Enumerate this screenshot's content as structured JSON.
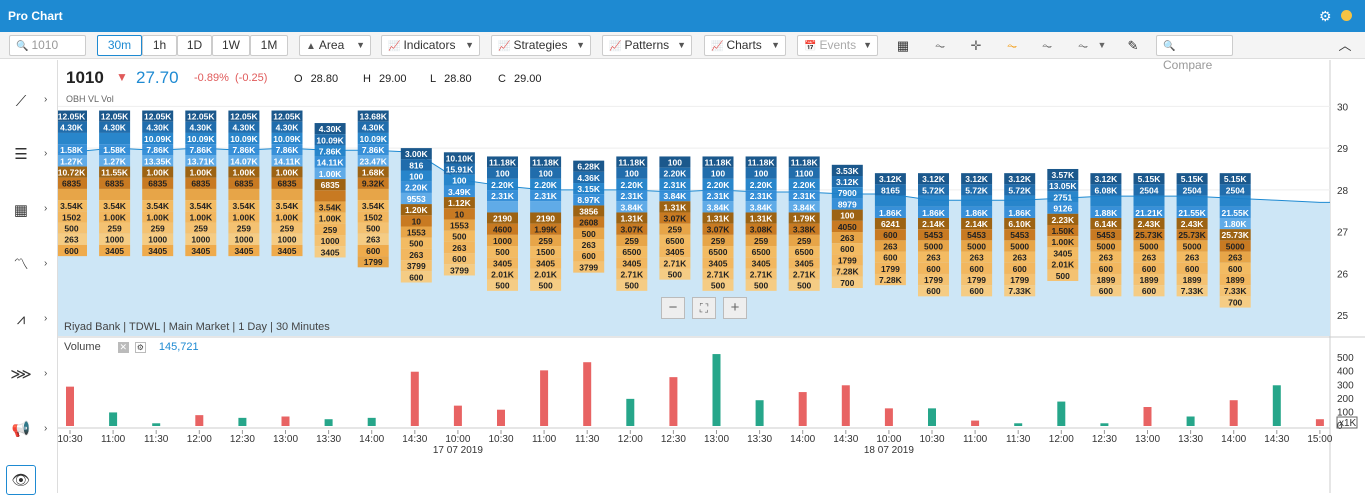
{
  "window": {
    "title": "Pro Chart"
  },
  "toolbar": {
    "search_placeholder": "1010",
    "periods": [
      "30m",
      "1h",
      "1D",
      "1W",
      "1M"
    ],
    "active_period": "30m",
    "chart_type": "Area",
    "indicators": "Indicators",
    "strategies": "Strategies",
    "patterns": "Patterns",
    "charts": "Charts",
    "events": "Events",
    "compare_placeholder": "Compare"
  },
  "quote": {
    "symbol": "1010",
    "last": "27.70",
    "change_pct": "-0.89%",
    "change": "(-0.25)",
    "open_label": "O",
    "open": "28.80",
    "high_label": "H",
    "high": "29.00",
    "low_label": "L",
    "low": "28.80",
    "close_label": "C",
    "close": "29.00",
    "overlay_label": "OBH VL Vol"
  },
  "meta": "Riyad Bank | TDWL | Main Market | 1 Day | 30 Minutes",
  "volume_panel": {
    "label": "Volume",
    "value": "145,721",
    "multiplier": "x1K"
  },
  "colors": {
    "up": "#26a68a",
    "down": "#e86363",
    "area": "#cde6f6",
    "line": "#1e8ad2"
  },
  "chart_data": {
    "type": "area",
    "price_axis": {
      "min": 24.5,
      "max": 30.2,
      "ticks": [
        "30",
        "29",
        "28",
        "27",
        "26",
        "25"
      ]
    },
    "volume_axis": {
      "min": 0,
      "max": 560,
      "ticks": [
        "500",
        "400",
        "300",
        "200",
        "100",
        "0"
      ]
    },
    "x": [
      "10:30",
      "11:00",
      "11:30",
      "12:00",
      "12:30",
      "13:00",
      "13:30",
      "14:00",
      "14:30",
      "10:00",
      "10:30",
      "11:00",
      "11:30",
      "12:00",
      "12:30",
      "13:00",
      "13:30",
      "14:00",
      "14:30",
      "10:00",
      "10:30",
      "11:00",
      "11:30",
      "12:00",
      "12:30",
      "13:00",
      "13:30",
      "14:00",
      "14:30",
      "15:00"
    ],
    "date_labels": [
      {
        "at": "10:00",
        "index": 9,
        "date": "17 07 2019"
      },
      {
        "at": "10:00",
        "index": 19,
        "date": "18 07 2019"
      }
    ],
    "price": [
      28.9,
      29.0,
      28.95,
      29.0,
      28.95,
      29.0,
      28.95,
      28.95,
      28.9,
      28.25,
      28.1,
      28.0,
      28.0,
      28.0,
      27.95,
      28.0,
      27.95,
      27.95,
      27.9,
      27.9,
      27.75,
      27.75,
      27.75,
      27.8,
      27.85,
      27.85,
      27.85,
      27.8,
      27.75,
      27.7
    ],
    "volume": [
      290,
      100,
      20,
      80,
      60,
      70,
      50,
      60,
      400,
      150,
      120,
      410,
      470,
      200,
      360,
      530,
      190,
      250,
      300,
      130,
      130,
      40,
      20,
      180,
      20,
      140,
      70,
      190,
      300,
      50
    ],
    "volume_direction": [
      "down",
      "up",
      "up",
      "down",
      "up",
      "down",
      "up",
      "up",
      "down",
      "down",
      "down",
      "down",
      "down",
      "up",
      "down",
      "up",
      "up",
      "down",
      "down",
      "down",
      "up",
      "down",
      "up",
      "up",
      "up",
      "down",
      "up",
      "down",
      "up",
      "down"
    ],
    "order_book_columns": [
      {
        "top": 29.9,
        "cells": [
          "12.05K",
          "4.30K",
          "",
          "1.58K",
          "1.27K",
          "10.72K",
          "6835",
          "",
          "3.54K",
          "1502",
          "500",
          "263",
          "600"
        ]
      },
      {
        "top": 29.9,
        "cells": [
          "12.05K",
          "4.30K",
          "",
          "1.58K",
          "1.27K",
          "11.55K",
          "6835",
          "",
          "3.54K",
          "1.00K",
          "259",
          "1000",
          "3405"
        ]
      },
      {
        "top": 29.9,
        "cells": [
          "12.05K",
          "4.30K",
          "10.09K",
          "7.86K",
          "13.35K",
          "1.00K",
          "6835",
          "",
          "3.54K",
          "1.00K",
          "259",
          "1000",
          "3405"
        ]
      },
      {
        "top": 29.9,
        "cells": [
          "12.05K",
          "4.30K",
          "10.09K",
          "7.86K",
          "13.71K",
          "1.00K",
          "6835",
          "",
          "3.54K",
          "1.00K",
          "259",
          "1000",
          "3405"
        ]
      },
      {
        "top": 29.9,
        "cells": [
          "12.05K",
          "4.30K",
          "10.09K",
          "7.86K",
          "14.07K",
          "1.00K",
          "6835",
          "",
          "3.54K",
          "1.00K",
          "259",
          "1000",
          "3405"
        ]
      },
      {
        "top": 29.9,
        "cells": [
          "12.05K",
          "4.30K",
          "10.09K",
          "7.86K",
          "14.11K",
          "1.00K",
          "6835",
          "",
          "3.54K",
          "1.00K",
          "259",
          "1000",
          "3405"
        ]
      },
      {
        "top": 29.6,
        "cells": [
          "4.30K",
          "10.09K",
          "7.86K",
          "14.11K",
          "1.00K",
          "6835",
          "",
          "3.54K",
          "1.00K",
          "259",
          "1000",
          "3405"
        ]
      },
      {
        "top": 29.9,
        "cells": [
          "13.68K",
          "4.30K",
          "10.09K",
          "7.86K",
          "23.47K",
          "1.68K",
          "9.32K",
          "",
          "3.54K",
          "1502",
          "500",
          "263",
          "600",
          "1799"
        ]
      },
      {
        "top": 29.0,
        "cells": [
          "3.00K",
          "816",
          "100",
          "2.20K",
          "9553",
          "1.20K",
          "10",
          "1553",
          "500",
          "263",
          "3799",
          "600"
        ]
      },
      {
        "top": 28.9,
        "cells": [
          "10.10K",
          "15.91K",
          "100",
          "3.49K",
          "1.12K",
          "10",
          "1553",
          "500",
          "263",
          "600",
          "3799"
        ]
      },
      {
        "top": 28.8,
        "cells": [
          "11.18K",
          "100",
          "2.20K",
          "2.31K",
          "",
          "2190",
          "4600",
          "1000",
          "500",
          "3405",
          "2.01K",
          "500"
        ]
      },
      {
        "top": 28.8,
        "cells": [
          "11.18K",
          "100",
          "2.20K",
          "2.31K",
          "",
          "2190",
          "1.99K",
          "259",
          "1500",
          "3405",
          "2.01K",
          "500"
        ]
      },
      {
        "top": 28.7,
        "cells": [
          "6.28K",
          "4.36K",
          "3.15K",
          "8.97K",
          "3856",
          "2608",
          "500",
          "263",
          "600",
          "3799"
        ]
      },
      {
        "top": 28.8,
        "cells": [
          "11.18K",
          "100",
          "2.20K",
          "2.31K",
          "3.84K",
          "1.31K",
          "3.07K",
          "259",
          "6500",
          "3405",
          "2.71K",
          "500"
        ]
      },
      {
        "top": 28.8,
        "cells": [
          "100",
          "2.20K",
          "2.31K",
          "3.84K",
          "1.31K",
          "3.07K",
          "259",
          "6500",
          "3405",
          "2.71K",
          "500"
        ]
      },
      {
        "top": 28.8,
        "cells": [
          "11.18K",
          "100",
          "2.20K",
          "2.31K",
          "3.84K",
          "1.31K",
          "3.07K",
          "259",
          "6500",
          "3405",
          "2.71K",
          "500"
        ]
      },
      {
        "top": 28.8,
        "cells": [
          "11.18K",
          "100",
          "2.20K",
          "2.31K",
          "3.84K",
          "1.31K",
          "3.08K",
          "259",
          "6500",
          "3405",
          "2.71K",
          "500"
        ]
      },
      {
        "top": 28.8,
        "cells": [
          "11.18K",
          "1100",
          "2.20K",
          "2.31K",
          "3.84K",
          "1.79K",
          "3.38K",
          "259",
          "6500",
          "3405",
          "2.71K",
          "500"
        ]
      },
      {
        "top": 28.6,
        "cells": [
          "3.53K",
          "3.12K",
          "7900",
          "8979",
          "100",
          "4050",
          "263",
          "600",
          "1799",
          "7.28K",
          "700"
        ]
      },
      {
        "top": 28.4,
        "cells": [
          "3.12K",
          "8165",
          "",
          "1.86K",
          "6241",
          "600",
          "263",
          "600",
          "1799",
          "7.28K"
        ]
      },
      {
        "top": 28.4,
        "cells": [
          "3.12K",
          "5.72K",
          "",
          "1.86K",
          "2.14K",
          "5453",
          "5000",
          "263",
          "600",
          "1799",
          "600"
        ]
      },
      {
        "top": 28.4,
        "cells": [
          "3.12K",
          "5.72K",
          "",
          "1.86K",
          "2.14K",
          "5453",
          "5000",
          "263",
          "600",
          "1799",
          "600"
        ]
      },
      {
        "top": 28.4,
        "cells": [
          "3.12K",
          "5.72K",
          "",
          "1.86K",
          "6.10K",
          "5453",
          "5000",
          "263",
          "600",
          "1799",
          "7.33K"
        ]
      },
      {
        "top": 28.5,
        "cells": [
          "3.57K",
          "13.05K",
          "2751",
          "9126",
          "2.23K",
          "1.50K",
          "1.00K",
          "3405",
          "2.01K",
          "500"
        ]
      },
      {
        "top": 28.4,
        "cells": [
          "3.12K",
          "6.08K",
          "",
          "1.88K",
          "6.14K",
          "5453",
          "5000",
          "263",
          "600",
          "1899",
          "600"
        ]
      },
      {
        "top": 28.4,
        "cells": [
          "5.15K",
          "2504",
          "",
          "21.21K",
          "2.43K",
          "25.73K",
          "5000",
          "263",
          "600",
          "1899",
          "600"
        ]
      },
      {
        "top": 28.4,
        "cells": [
          "5.15K",
          "2504",
          "",
          "21.55K",
          "2.43K",
          "25.73K",
          "5000",
          "263",
          "600",
          "1899",
          "7.33K"
        ]
      },
      {
        "top": 28.4,
        "cells": [
          "5.15K",
          "2504",
          "",
          "21.55K",
          "1.80K",
          "25.73K",
          "5000",
          "263",
          "600",
          "1899",
          "7.33K",
          "700"
        ]
      }
    ]
  }
}
